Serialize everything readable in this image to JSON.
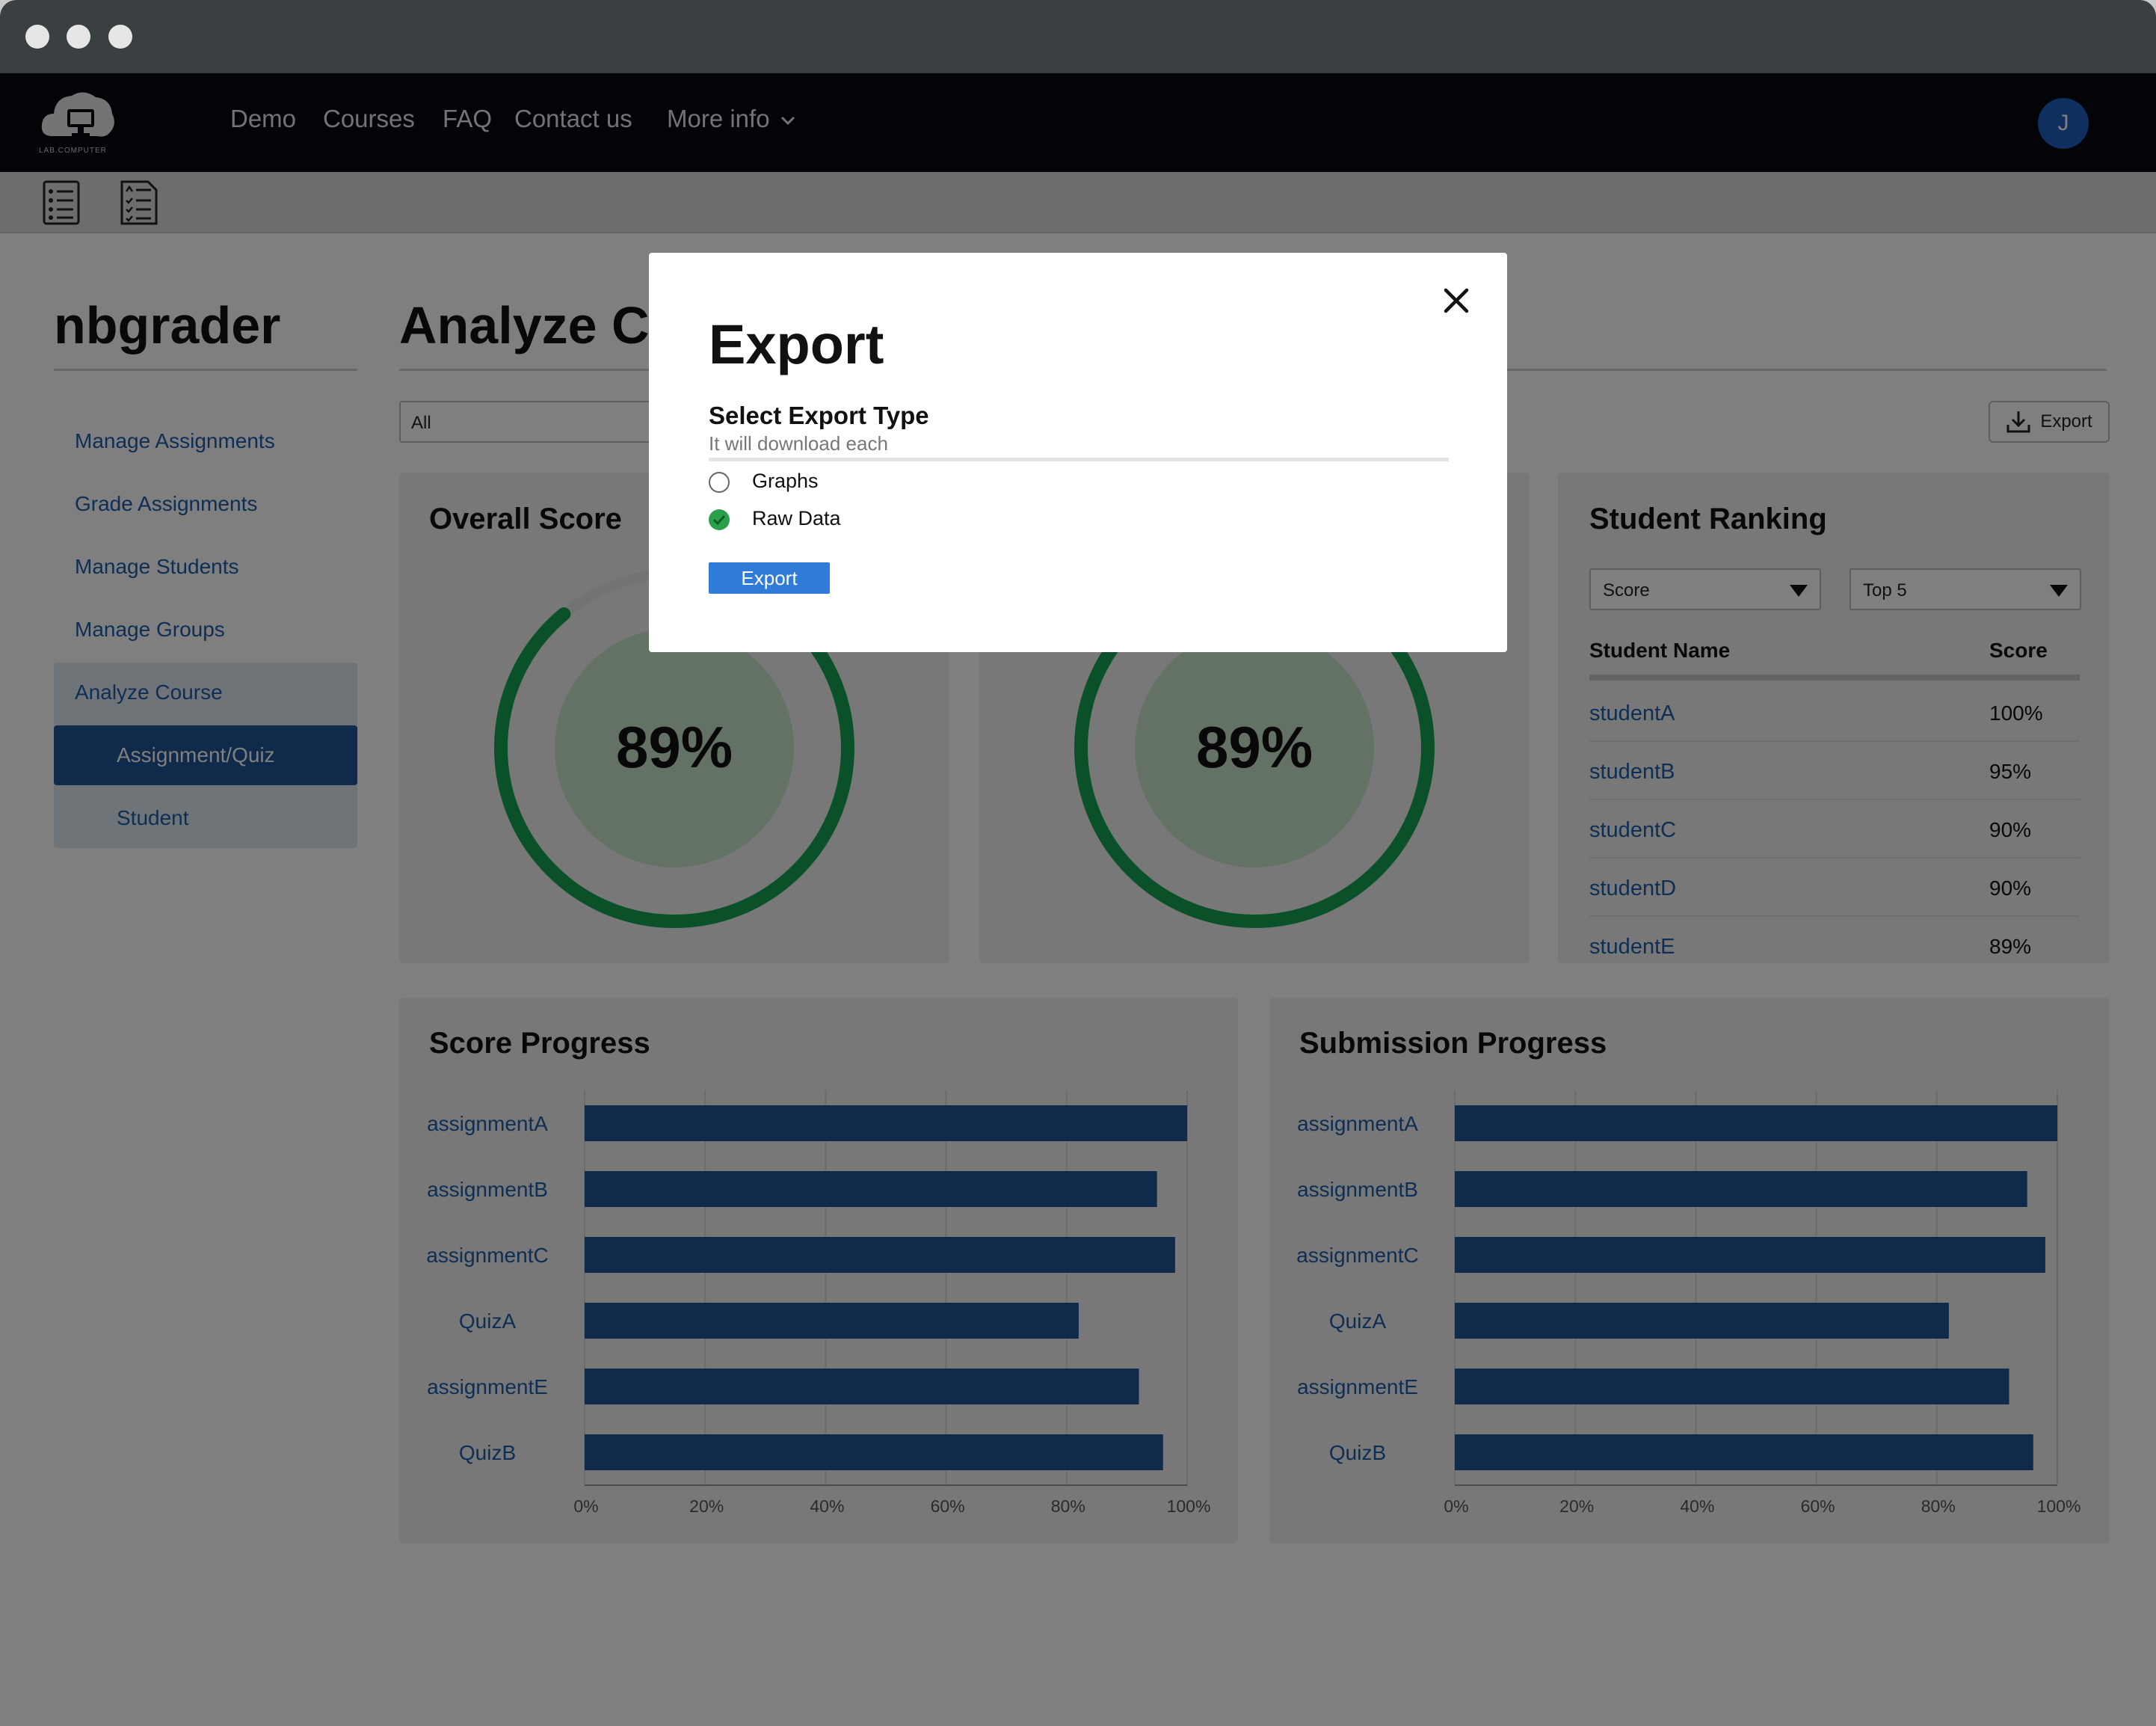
{
  "nav": {
    "logo_text": "LAB.COMPUTER",
    "items": [
      "Demo",
      "Courses",
      "FAQ",
      "Contact us",
      "More info"
    ],
    "avatar_initial": "J"
  },
  "sidebar": {
    "brand": "nbgrader",
    "items": [
      "Manage Assignments",
      "Grade Assignments",
      "Manage Students",
      "Manage Groups",
      "Analyze Course"
    ],
    "subitems": [
      "Assignment/Quiz",
      "Student"
    ]
  },
  "main": {
    "title": "Analyze Course",
    "filter_value": "All",
    "export_label": "Export"
  },
  "cards": {
    "overall_title": "Overall Score",
    "overall_value": "89%",
    "overall_fraction": 0.89,
    "second_value": "89%",
    "second_fraction": 0.89
  },
  "ranking": {
    "title": "Student Ranking",
    "sort_select": "Score",
    "limit_select": "Top 5",
    "col_name": "Student Name",
    "col_score": "Score",
    "rows": [
      {
        "name": "studentA",
        "score": "100%"
      },
      {
        "name": "studentB",
        "score": "95%"
      },
      {
        "name": "studentC",
        "score": "90%"
      },
      {
        "name": "studentD",
        "score": "90%"
      },
      {
        "name": "studentE",
        "score": "89%"
      }
    ]
  },
  "chart_data": [
    {
      "type": "bar",
      "title": "Score Progress",
      "categories": [
        "assignmentA",
        "assignmentB",
        "assignmentC",
        "QuizA",
        "assignmentE",
        "QuizB"
      ],
      "values": [
        100,
        95,
        98,
        82,
        92,
        96
      ],
      "xticks": [
        "0%",
        "20%",
        "40%",
        "60%",
        "80%",
        "100%"
      ],
      "xlim": [
        0,
        100
      ],
      "orientation": "horizontal",
      "grid": true,
      "bar_color": "#1f5594"
    },
    {
      "type": "bar",
      "title": "Submission Progress",
      "categories": [
        "assignmentA",
        "assignmentB",
        "assignmentC",
        "QuizA",
        "assignmentE",
        "QuizB"
      ],
      "values": [
        100,
        95,
        98,
        82,
        92,
        96
      ],
      "xticks": [
        "0%",
        "20%",
        "40%",
        "60%",
        "80%",
        "100%"
      ],
      "xlim": [
        0,
        100
      ],
      "orientation": "horizontal",
      "grid": true,
      "bar_color": "#1f5594"
    }
  ],
  "modal": {
    "title": "Export",
    "subtitle": "Select Export Type",
    "hint": "It will download each",
    "options": [
      {
        "label": "Graphs",
        "checked": false
      },
      {
        "label": "Raw Data",
        "checked": true
      }
    ],
    "export_label": "Export",
    "close_icon": "close-icon"
  },
  "colors": {
    "accent": "#1f5594",
    "link": "#1c5da8",
    "gauge": "#14a050",
    "export_button": "#2f7bd8",
    "checked": "#2aa04a"
  }
}
